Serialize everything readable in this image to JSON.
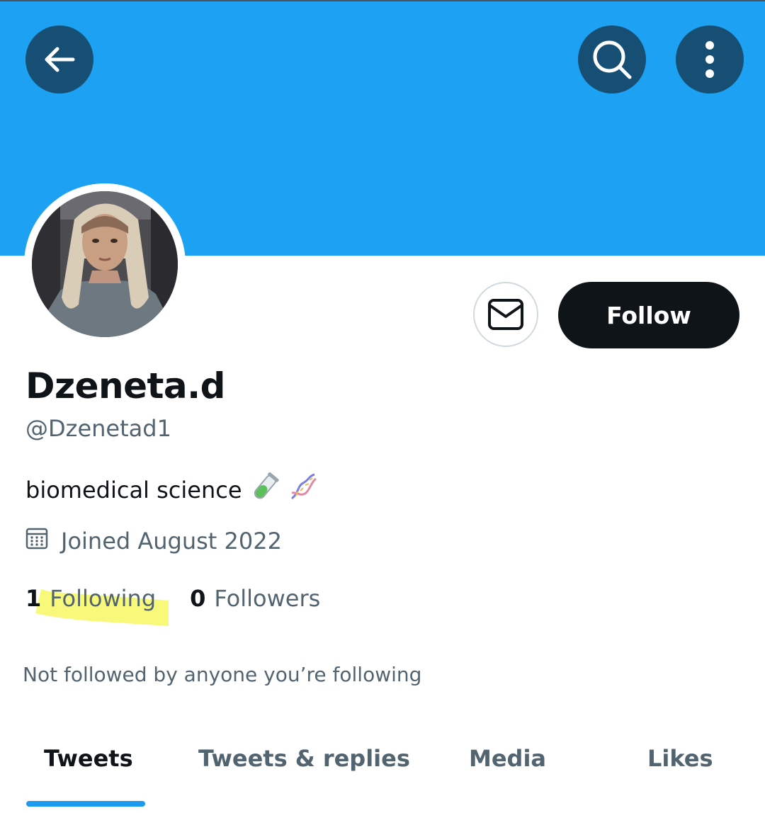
{
  "colors": {
    "banner": "#1da1f2",
    "header_button": "#164f73",
    "follow_button": "#0f1419",
    "tab_indicator": "#1d9bf0",
    "secondary_text": "#536471",
    "highlight": "#f6f75a"
  },
  "header": {
    "back_icon": "arrow-left-icon",
    "search_icon": "search-icon",
    "more_icon": "more-vertical-icon"
  },
  "profile": {
    "display_name": "Dzeneta.d",
    "handle": "@Dzenetad1",
    "bio_text": "biomedical science",
    "bio_emoji": [
      "test-tube-emoji",
      "dna-emoji"
    ],
    "joined": "Joined August 2022",
    "following_count": "1",
    "following_label": "Following",
    "followers_count": "0",
    "followers_label": "Followers",
    "mutuals_note": "Not followed by anyone you’re following"
  },
  "actions": {
    "message_icon": "envelope-icon",
    "follow_label": "Follow"
  },
  "tabs": [
    {
      "label": "Tweets",
      "active": true
    },
    {
      "label": "Tweets & replies",
      "active": false
    },
    {
      "label": "Media",
      "active": false
    },
    {
      "label": "Likes",
      "active": false
    }
  ]
}
